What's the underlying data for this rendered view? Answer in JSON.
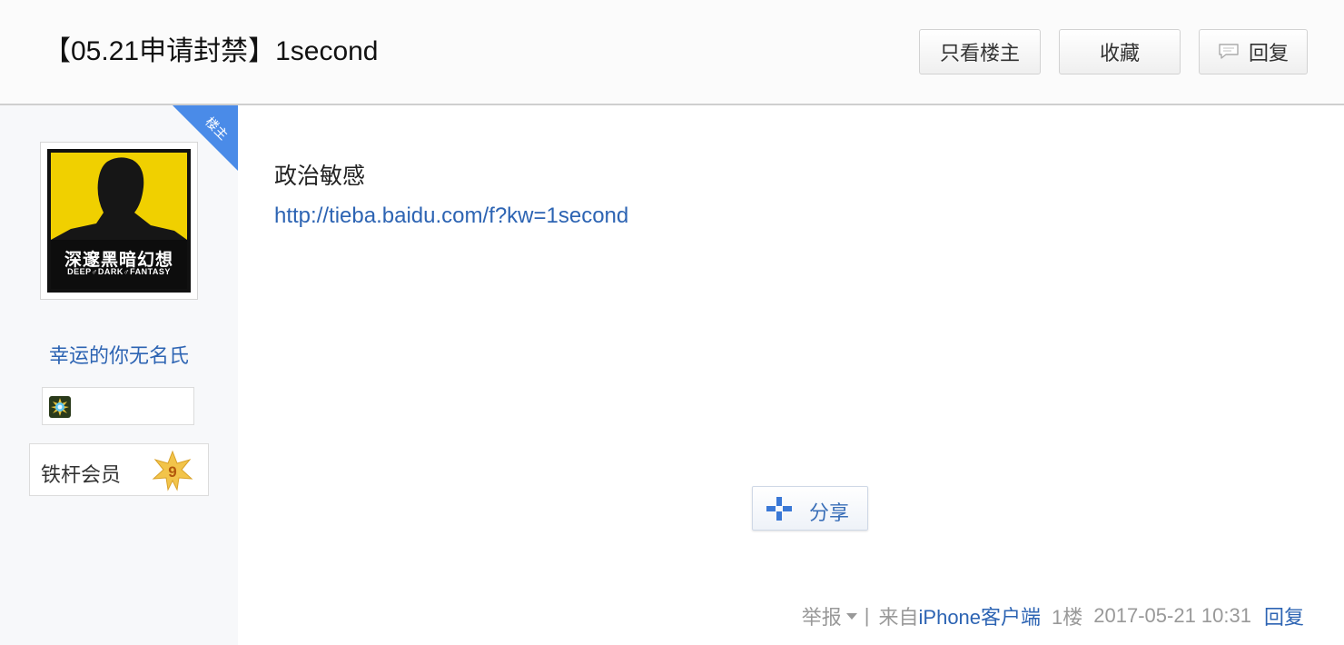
{
  "header": {
    "title": "【05.21申请封禁】1second",
    "only_op_label": "只看楼主",
    "favorite_label": "收藏",
    "reply_label": "回复"
  },
  "author": {
    "avatar_text_cn": "深邃黑暗幻想",
    "avatar_text_en": "DEEP♂DARK♂FANTASY",
    "username": "幸运的你无名氏",
    "corner_badge": "楼主",
    "level_label": "铁杆会员",
    "level_number": "9"
  },
  "post": {
    "text": "政治敏感",
    "link": "http://tieba.baidu.com/f?kw=1second",
    "share_label": "分享"
  },
  "footer": {
    "report_label": "举报",
    "separator": "|",
    "from_prefix": "来自",
    "device": "iPhone客户端",
    "floor": "1楼",
    "timestamp": "2017-05-21 10:31",
    "reply_label": "回复"
  },
  "colors": {
    "link_blue": "#2d64b3",
    "corner_blue": "#4a8be8",
    "avatar_yellow": "#f0d000"
  },
  "icons": {
    "reply_button": "speech-bubble-icon",
    "share_button": "plus-icon",
    "badge": "gem-icon",
    "level": "star-badge-icon"
  }
}
